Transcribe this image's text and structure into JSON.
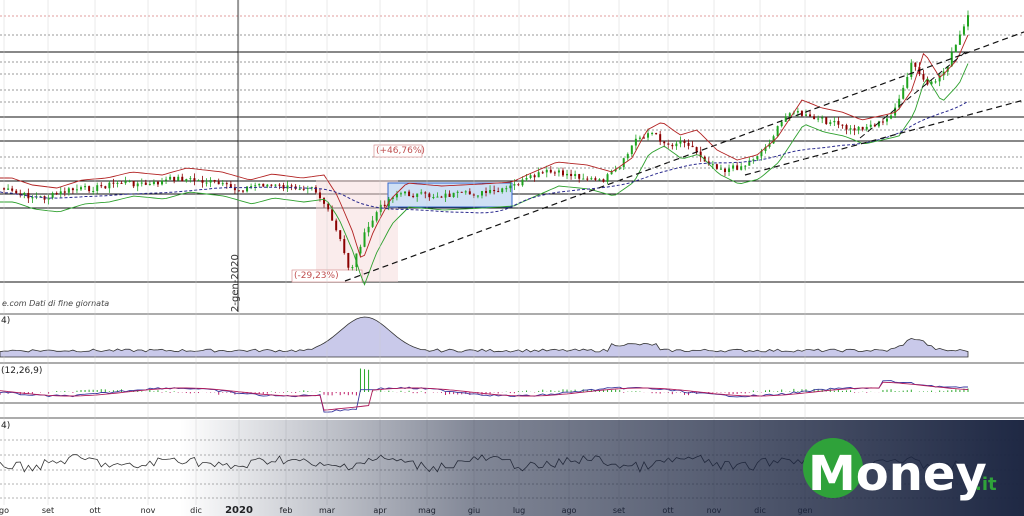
{
  "watermark": "Money",
  "watermark_tld": ".it",
  "source_note": "e.com  Dati di fine giornata",
  "date_marker": "2-gen-2020",
  "annotations": {
    "drawdown": "(-29,23%)",
    "rebound": "(+46,76%)"
  },
  "indicator_labels": {
    "top": "4)",
    "macd": "(12,26,9)",
    "bottom": "4)"
  },
  "colors": {
    "up": "#1fa31f",
    "down": "#8b0000",
    "resistance": "#b22222",
    "support": "#2ea02e",
    "ma": "#2b2b8f",
    "volume": "#9a9ad0",
    "macd": "#3a3aa0",
    "signal": "#b01a5a",
    "hist_pos": "#2aa82a",
    "hist_neg": "#c0206a",
    "brand_green": "#2fa23a",
    "brand_navy": "#1a2440"
  },
  "chart_data": [
    {
      "type": "candlestick",
      "x_ticks": [
        "go",
        "set",
        "ott",
        "nov",
        "dic",
        "2020",
        "feb",
        "mar",
        "apr",
        "mag",
        "giu",
        "lug",
        "ago",
        "set",
        "ott",
        "nov",
        "dic",
        "gen"
      ],
      "series_desc": "Price rises from Aug 2019 through Jan 2021; crash in Mar 2020 (-29,23%) followed by rebound (+46,76%); new highs in late 2020",
      "lines": [
        "price",
        "upper band",
        "lower band",
        "moving average"
      ],
      "horizontal_levels": 15,
      "trend_lines": 3,
      "grid": true
    },
    {
      "type": "area",
      "label": "4)",
      "desc": "volatility indicator, peak near Mar 2020"
    },
    {
      "type": "line",
      "label": "(12,26,9)",
      "series": [
        {
          "name": "MACD"
        },
        {
          "name": "signal"
        }
      ],
      "histogram": true
    },
    {
      "type": "line",
      "label": "4)",
      "desc": "oscillator"
    }
  ]
}
